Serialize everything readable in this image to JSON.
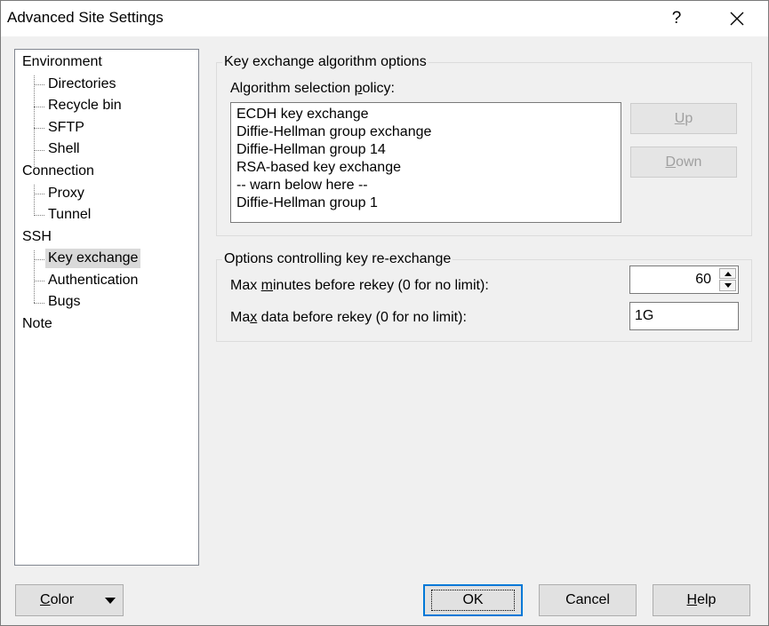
{
  "window": {
    "title": "Advanced Site Settings",
    "help_glyph": "?",
    "close_glyph": "✕"
  },
  "tree": {
    "items": [
      {
        "label": "Environment"
      },
      {
        "label": "Directories"
      },
      {
        "label": "Recycle bin"
      },
      {
        "label": "SFTP"
      },
      {
        "label": "Shell"
      },
      {
        "label": "Connection"
      },
      {
        "label": "Proxy"
      },
      {
        "label": "Tunnel"
      },
      {
        "label": "SSH"
      },
      {
        "label": "Key exchange"
      },
      {
        "label": "Authentication"
      },
      {
        "label": "Bugs"
      },
      {
        "label": "Note"
      }
    ],
    "selected": "Key exchange"
  },
  "kex": {
    "group_title": "Key exchange algorithm options",
    "policy_label_pre": "Algorithm selection ",
    "policy_label_accel": "p",
    "policy_label_post": "olicy:",
    "algorithms": [
      "ECDH key exchange",
      "Diffie-Hellman group exchange",
      "Diffie-Hellman group 14",
      "RSA-based key exchange",
      "-- warn below here --",
      "Diffie-Hellman group 1"
    ],
    "up_accel": "U",
    "up_rest": "p",
    "down_accel": "D",
    "down_rest": "own"
  },
  "rekey": {
    "group_title": "Options controlling key re-exchange",
    "minutes_label_pre": "Max ",
    "minutes_label_accel": "m",
    "minutes_label_post": "inutes before rekey (0 for no limit):",
    "minutes_value": "60",
    "data_label_pre": "Ma",
    "data_label_accel": "x",
    "data_label_post": " data before rekey (0 for no limit):",
    "data_value": "1G"
  },
  "footer": {
    "color_accel": "C",
    "color_rest": "olor",
    "ok_label": "OK",
    "cancel_label": "Cancel",
    "help_accel": "H",
    "help_rest": "elp"
  }
}
